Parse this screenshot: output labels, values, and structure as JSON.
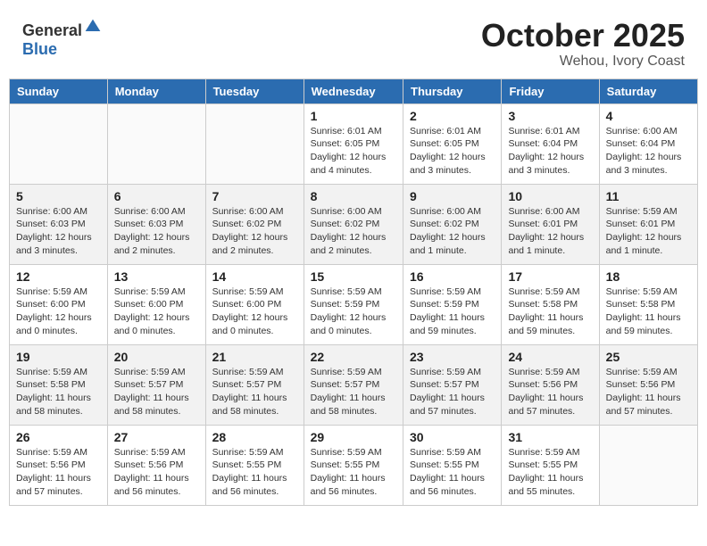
{
  "header": {
    "logo_general": "General",
    "logo_blue": "Blue",
    "month": "October 2025",
    "location": "Wehou, Ivory Coast"
  },
  "weekdays": [
    "Sunday",
    "Monday",
    "Tuesday",
    "Wednesday",
    "Thursday",
    "Friday",
    "Saturday"
  ],
  "weeks": [
    [
      {
        "day": "",
        "info": ""
      },
      {
        "day": "",
        "info": ""
      },
      {
        "day": "",
        "info": ""
      },
      {
        "day": "1",
        "info": "Sunrise: 6:01 AM\nSunset: 6:05 PM\nDaylight: 12 hours\nand 4 minutes."
      },
      {
        "day": "2",
        "info": "Sunrise: 6:01 AM\nSunset: 6:05 PM\nDaylight: 12 hours\nand 3 minutes."
      },
      {
        "day": "3",
        "info": "Sunrise: 6:01 AM\nSunset: 6:04 PM\nDaylight: 12 hours\nand 3 minutes."
      },
      {
        "day": "4",
        "info": "Sunrise: 6:00 AM\nSunset: 6:04 PM\nDaylight: 12 hours\nand 3 minutes."
      }
    ],
    [
      {
        "day": "5",
        "info": "Sunrise: 6:00 AM\nSunset: 6:03 PM\nDaylight: 12 hours\nand 3 minutes."
      },
      {
        "day": "6",
        "info": "Sunrise: 6:00 AM\nSunset: 6:03 PM\nDaylight: 12 hours\nand 2 minutes."
      },
      {
        "day": "7",
        "info": "Sunrise: 6:00 AM\nSunset: 6:02 PM\nDaylight: 12 hours\nand 2 minutes."
      },
      {
        "day": "8",
        "info": "Sunrise: 6:00 AM\nSunset: 6:02 PM\nDaylight: 12 hours\nand 2 minutes."
      },
      {
        "day": "9",
        "info": "Sunrise: 6:00 AM\nSunset: 6:02 PM\nDaylight: 12 hours\nand 1 minute."
      },
      {
        "day": "10",
        "info": "Sunrise: 6:00 AM\nSunset: 6:01 PM\nDaylight: 12 hours\nand 1 minute."
      },
      {
        "day": "11",
        "info": "Sunrise: 5:59 AM\nSunset: 6:01 PM\nDaylight: 12 hours\nand 1 minute."
      }
    ],
    [
      {
        "day": "12",
        "info": "Sunrise: 5:59 AM\nSunset: 6:00 PM\nDaylight: 12 hours\nand 0 minutes."
      },
      {
        "day": "13",
        "info": "Sunrise: 5:59 AM\nSunset: 6:00 PM\nDaylight: 12 hours\nand 0 minutes."
      },
      {
        "day": "14",
        "info": "Sunrise: 5:59 AM\nSunset: 6:00 PM\nDaylight: 12 hours\nand 0 minutes."
      },
      {
        "day": "15",
        "info": "Sunrise: 5:59 AM\nSunset: 5:59 PM\nDaylight: 12 hours\nand 0 minutes."
      },
      {
        "day": "16",
        "info": "Sunrise: 5:59 AM\nSunset: 5:59 PM\nDaylight: 11 hours\nand 59 minutes."
      },
      {
        "day": "17",
        "info": "Sunrise: 5:59 AM\nSunset: 5:58 PM\nDaylight: 11 hours\nand 59 minutes."
      },
      {
        "day": "18",
        "info": "Sunrise: 5:59 AM\nSunset: 5:58 PM\nDaylight: 11 hours\nand 59 minutes."
      }
    ],
    [
      {
        "day": "19",
        "info": "Sunrise: 5:59 AM\nSunset: 5:58 PM\nDaylight: 11 hours\nand 58 minutes."
      },
      {
        "day": "20",
        "info": "Sunrise: 5:59 AM\nSunset: 5:57 PM\nDaylight: 11 hours\nand 58 minutes."
      },
      {
        "day": "21",
        "info": "Sunrise: 5:59 AM\nSunset: 5:57 PM\nDaylight: 11 hours\nand 58 minutes."
      },
      {
        "day": "22",
        "info": "Sunrise: 5:59 AM\nSunset: 5:57 PM\nDaylight: 11 hours\nand 58 minutes."
      },
      {
        "day": "23",
        "info": "Sunrise: 5:59 AM\nSunset: 5:57 PM\nDaylight: 11 hours\nand 57 minutes."
      },
      {
        "day": "24",
        "info": "Sunrise: 5:59 AM\nSunset: 5:56 PM\nDaylight: 11 hours\nand 57 minutes."
      },
      {
        "day": "25",
        "info": "Sunrise: 5:59 AM\nSunset: 5:56 PM\nDaylight: 11 hours\nand 57 minutes."
      }
    ],
    [
      {
        "day": "26",
        "info": "Sunrise: 5:59 AM\nSunset: 5:56 PM\nDaylight: 11 hours\nand 57 minutes."
      },
      {
        "day": "27",
        "info": "Sunrise: 5:59 AM\nSunset: 5:56 PM\nDaylight: 11 hours\nand 56 minutes."
      },
      {
        "day": "28",
        "info": "Sunrise: 5:59 AM\nSunset: 5:55 PM\nDaylight: 11 hours\nand 56 minutes."
      },
      {
        "day": "29",
        "info": "Sunrise: 5:59 AM\nSunset: 5:55 PM\nDaylight: 11 hours\nand 56 minutes."
      },
      {
        "day": "30",
        "info": "Sunrise: 5:59 AM\nSunset: 5:55 PM\nDaylight: 11 hours\nand 56 minutes."
      },
      {
        "day": "31",
        "info": "Sunrise: 5:59 AM\nSunset: 5:55 PM\nDaylight: 11 hours\nand 55 minutes."
      },
      {
        "day": "",
        "info": ""
      }
    ]
  ]
}
